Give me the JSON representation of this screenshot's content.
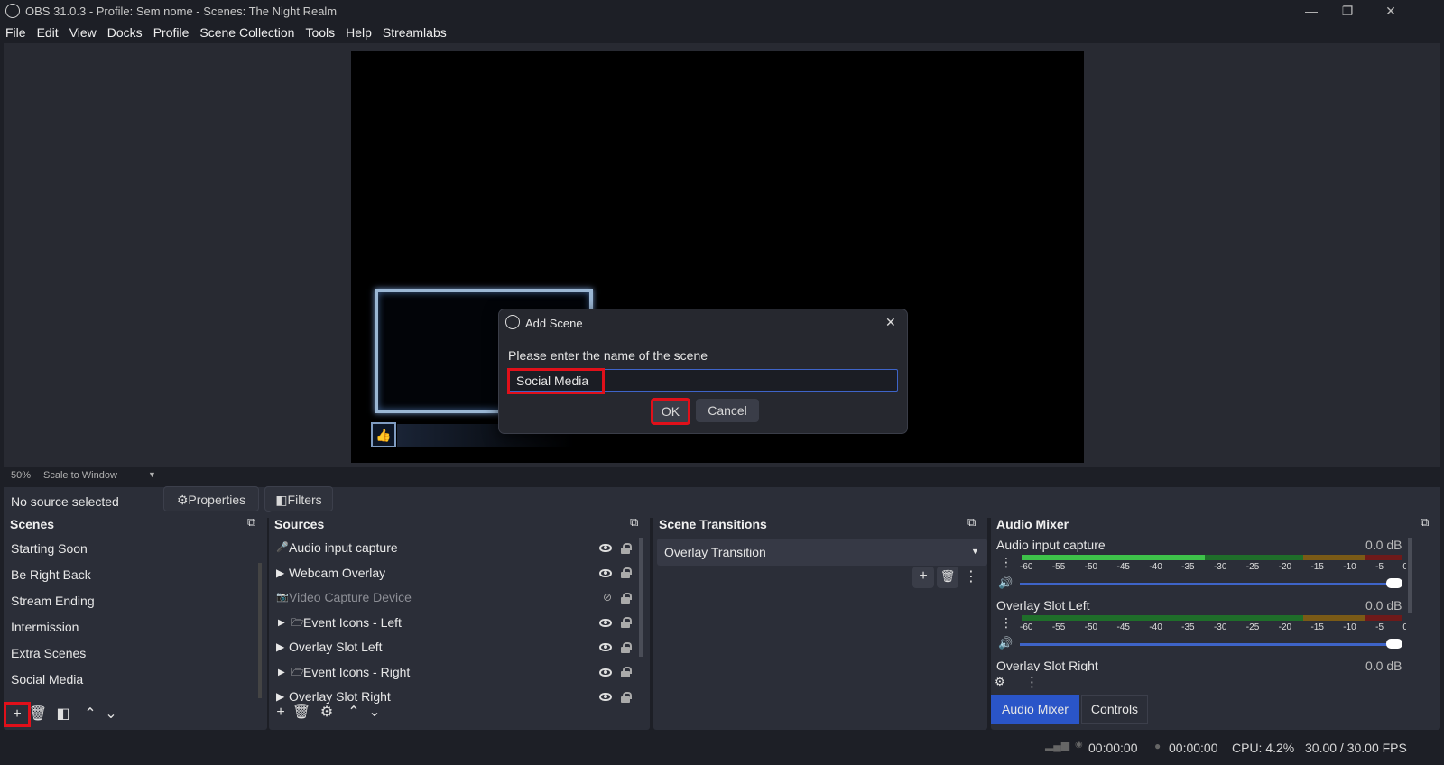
{
  "window": {
    "title": "OBS 31.0.3 - Profile: Sem nome - Scenes: The Night Realm",
    "minimize": "—",
    "maximize": "❐",
    "close": "✕"
  },
  "menu": [
    "File",
    "Edit",
    "View",
    "Docks",
    "Profile",
    "Scene Collection",
    "Tools",
    "Help",
    "Streamlabs"
  ],
  "preview": {
    "zoom": "50%",
    "scale_mode": "Scale to Window",
    "dropdown_arrow": "▼"
  },
  "source_bar": {
    "status": "No source selected",
    "properties": "Properties",
    "filters": "Filters"
  },
  "dialog": {
    "title": "Add Scene",
    "prompt": "Please enter the name of the scene",
    "input_value": "Social Media",
    "ok": "OK",
    "cancel": "Cancel",
    "close": "✕"
  },
  "scenes": {
    "title": "Scenes",
    "items": [
      "Starting Soon",
      "Be Right Back",
      "Stream Ending",
      "Intermission",
      "Extra Scenes",
      "Social Media"
    ]
  },
  "sources": {
    "title": "Sources",
    "items": [
      {
        "icon": "🎤",
        "name": "Audio input capture"
      },
      {
        "icon": "▶",
        "name": "Webcam Overlay"
      },
      {
        "icon": "📷",
        "name": "Video Capture Device"
      },
      {
        "icon": "🗁",
        "name": "Event Icons - Left"
      },
      {
        "icon": "▶",
        "name": "Overlay Slot Left"
      },
      {
        "icon": "🗁",
        "name": "Event Icons - Right"
      },
      {
        "icon": "▶",
        "name": "Overlay Slot Right"
      }
    ]
  },
  "transitions": {
    "title": "Scene Transitions",
    "selected": "Overlay Transition"
  },
  "mixer": {
    "title": "Audio Mixer",
    "ticks": [
      "-60",
      "-55",
      "-50",
      "-45",
      "-40",
      "-35",
      "-30",
      "-25",
      "-20",
      "-15",
      "-10",
      "-5",
      "0"
    ],
    "channels": [
      {
        "name": "Audio input capture",
        "db": "0.0 dB",
        "level": 0.48
      },
      {
        "name": "Overlay Slot Left",
        "db": "0.0 dB",
        "level": 0
      },
      {
        "name": "Overlay Slot Right",
        "db": "0.0 dB",
        "level": 0
      }
    ],
    "tab_mixer": "Audio Mixer",
    "tab_controls": "Controls"
  },
  "status": {
    "rec_time": "00:00:00",
    "stream_time": "00:00:00",
    "cpu": "CPU: 4.2%",
    "fps": "30.00 / 30.00 FPS"
  },
  "colors": {
    "accent": "#2a55c8",
    "highlight": "#e0101a",
    "panel": "#2b2e38"
  }
}
